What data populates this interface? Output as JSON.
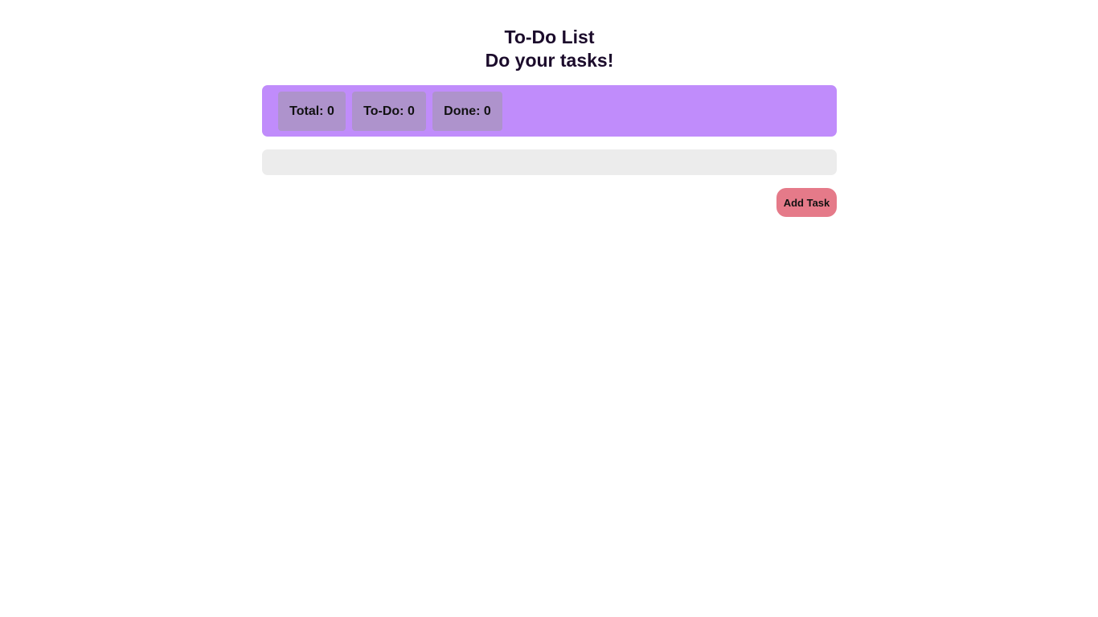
{
  "header": {
    "title": "To-Do List",
    "subtitle": "Do your tasks!"
  },
  "stats": [
    {
      "label": "Total: 0"
    },
    {
      "label": "To-Do: 0"
    },
    {
      "label": "Done: 0"
    }
  ],
  "actions": {
    "add_label": "Add Task"
  },
  "colors": {
    "stats_bg": "#c08cfb",
    "stat_box": "#ae93cc",
    "add_button": "#e57a89",
    "list_bg": "#ececec"
  }
}
